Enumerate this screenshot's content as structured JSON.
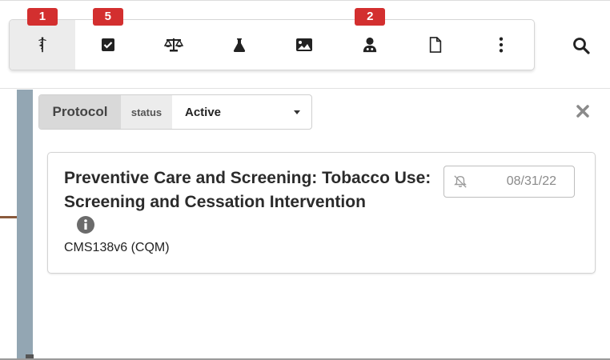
{
  "toolbar": {
    "buttons": [
      {
        "icon": "caduceus-icon",
        "badge": "1",
        "active": true
      },
      {
        "icon": "checkbox-icon",
        "badge": "5"
      },
      {
        "icon": "scale-icon",
        "badge": ""
      },
      {
        "icon": "flask-icon",
        "badge": ""
      },
      {
        "icon": "image-icon",
        "badge": ""
      },
      {
        "icon": "doctor-icon",
        "badge": "2"
      },
      {
        "icon": "document-icon",
        "badge": ""
      },
      {
        "icon": "more-vertical-icon",
        "badge": ""
      }
    ],
    "search_icon": "search-icon"
  },
  "filter": {
    "label": "Protocol",
    "sublabel": "status",
    "selected": "Active"
  },
  "card": {
    "title": "Preventive Care and Screening: Tobacco Use: Screening and Cessation Intervention",
    "code": "CMS138v6  (CQM)",
    "date": "08/31/22",
    "bell_icon": "bell-slash-icon",
    "info_icon": "info-icon"
  },
  "colors": {
    "badge": "#d32f2f",
    "strip": "#93a6b3",
    "active_bg": "#ececec"
  }
}
